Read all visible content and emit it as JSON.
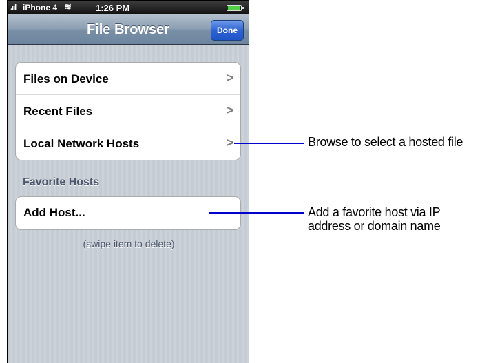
{
  "status_bar": {
    "signal": ".ııl",
    "carrier": "iPhone 4",
    "wifi": "≋",
    "time": "1:26 PM",
    "battery_icon": "battery-icon"
  },
  "navbar": {
    "title": "File Browser",
    "done_label": "Done"
  },
  "main_list": {
    "items": [
      {
        "label": "Files on Device",
        "icon": "chevron-right-icon"
      },
      {
        "label": "Recent Files",
        "icon": "chevron-right-icon"
      },
      {
        "label": "Local Network Hosts",
        "icon": "chevron-right-icon"
      }
    ]
  },
  "favorites": {
    "header": "Favorite Hosts",
    "items": [
      {
        "label": "Add Host..."
      }
    ],
    "footer": "(swipe item to delete)"
  },
  "callouts": {
    "browse": "Browse to select a hosted file",
    "favorite_line1": "Add a favorite host via IP",
    "favorite_line2": "address or domain name"
  },
  "colors": {
    "leader_line": "#0000cc",
    "done_button": "#2e63d1",
    "navbar": "#8a9db1"
  }
}
